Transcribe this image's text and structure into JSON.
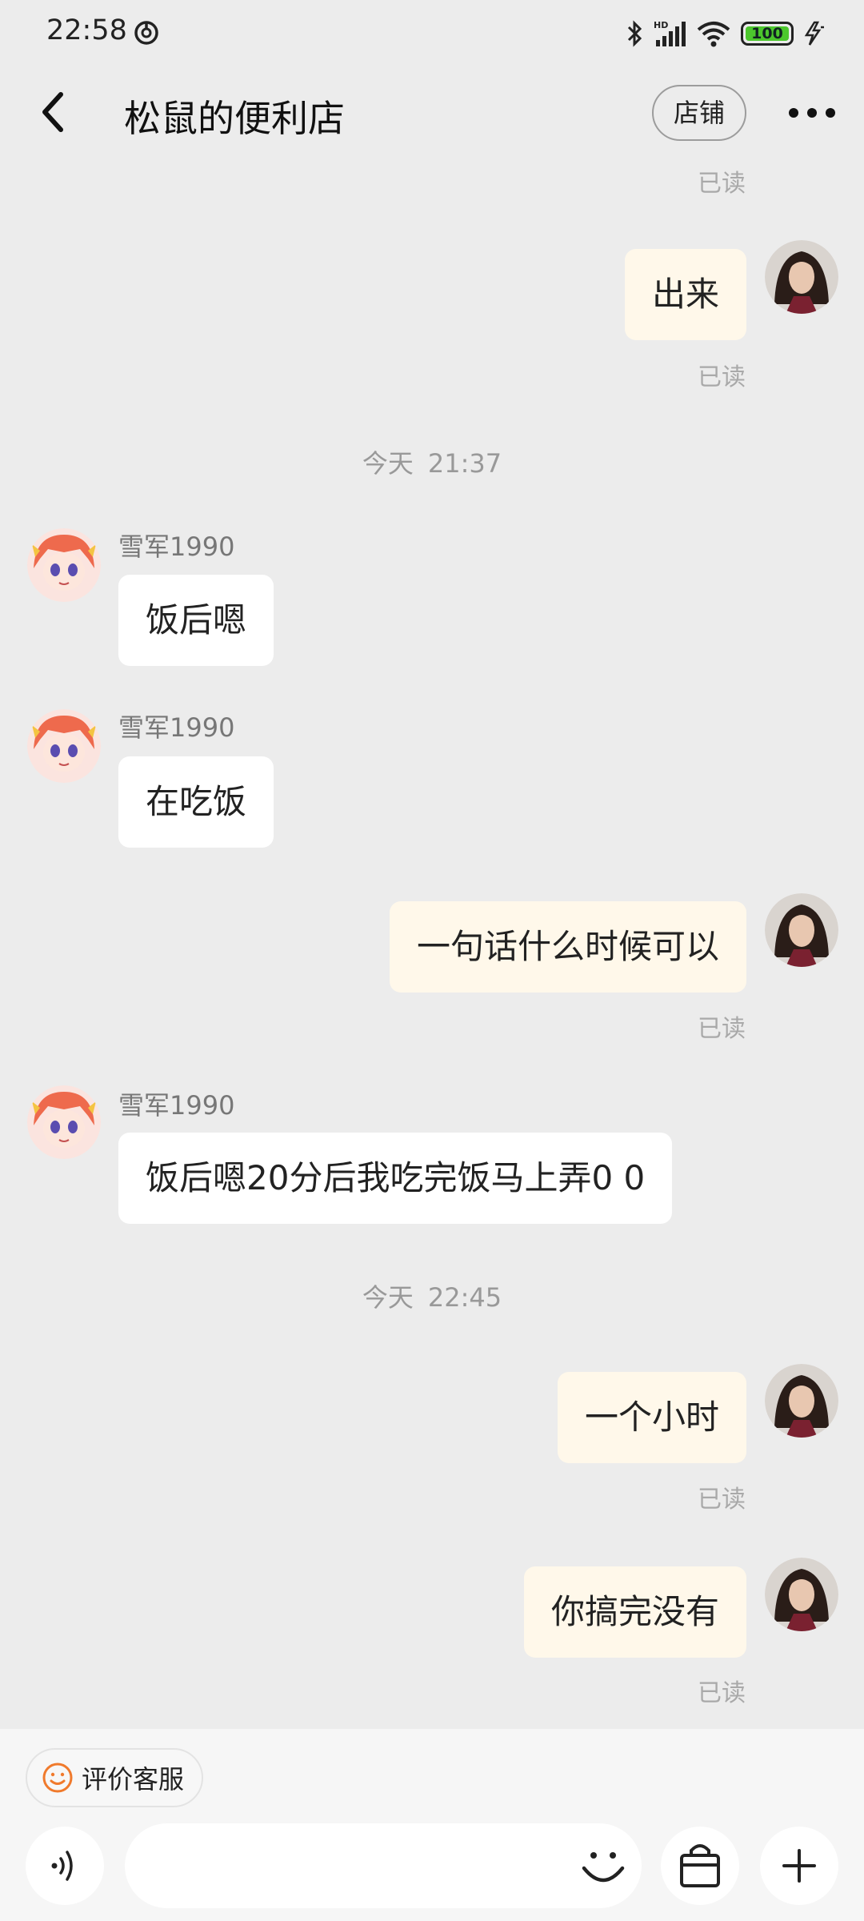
{
  "status_bar": {
    "time": "22:58",
    "battery": "100",
    "icons": [
      "network-activity-icon",
      "bluetooth-icon",
      "hd-signal-icon",
      "wifi-icon",
      "battery-icon",
      "charging-icon"
    ]
  },
  "header": {
    "title": "松鼠的便利店",
    "store_button": "店铺",
    "back_icon": "back-arrow-icon",
    "more_icon": "more-dots-icon"
  },
  "chat": {
    "read_label": "已读",
    "timestamps": [
      {
        "day": "今天",
        "time": "21:37"
      },
      {
        "day": "今天",
        "time": "22:45"
      }
    ],
    "messages": [
      {
        "from": "me",
        "text": "出来",
        "read": true
      },
      {
        "from": "them",
        "sender": "雪军1990",
        "text": "饭后嗯"
      },
      {
        "from": "them",
        "sender": "雪军1990",
        "text": "在吃饭"
      },
      {
        "from": "me",
        "text": "一句话什么时候可以",
        "read": true
      },
      {
        "from": "them",
        "sender": "雪军1990",
        "text": "饭后嗯20分后我吃完饭马上弄0 0"
      },
      {
        "from": "me",
        "text": "一个小时",
        "read": true
      },
      {
        "from": "me",
        "text": "你搞完没有",
        "read": true
      }
    ]
  },
  "bottom_bar": {
    "evaluate_label": "评价客服",
    "input_placeholder": "",
    "icons": [
      "smile-icon",
      "voice-icon",
      "emoji-icon",
      "shopping-bag-icon",
      "plus-icon"
    ]
  },
  "colors": {
    "background": "#ececec",
    "my_bubble": "#fff8ea",
    "their_bubble": "#ffffff",
    "accent_orange": "#f07a2c",
    "battery_green": "#4cc72d"
  }
}
